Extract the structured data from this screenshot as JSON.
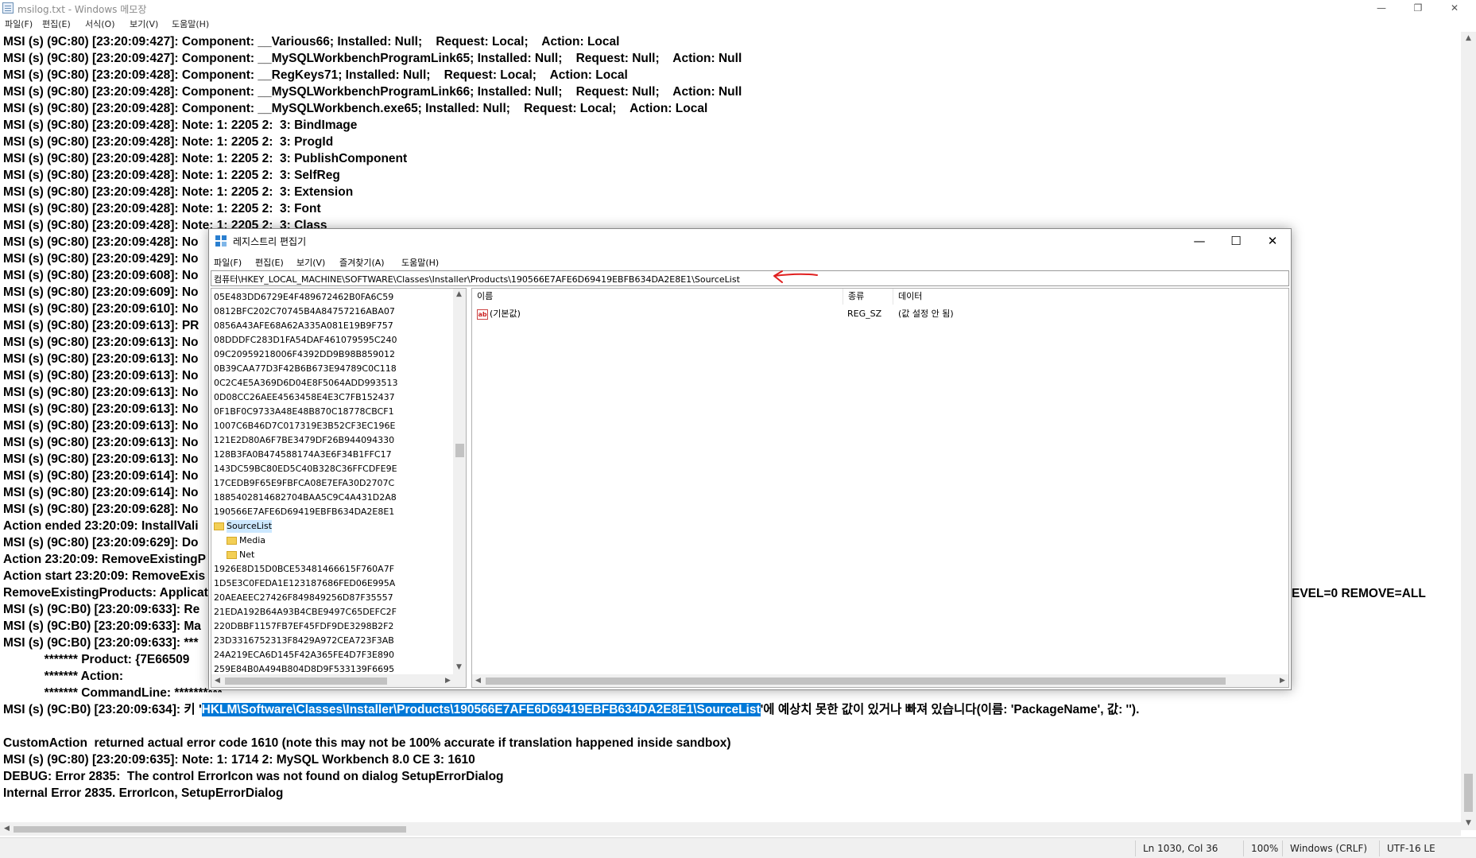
{
  "notepad": {
    "title": "msilog.txt - Windows 메모장",
    "menu": [
      "파일(F)",
      "편집(E)",
      "서식(O)",
      "보기(V)",
      "도움말(H)"
    ],
    "lines": [
      "MSI (s) (9C:80) [23:20:09:427]: Component: __Various66; Installed: Null;    Request: Local;    Action: Local",
      "MSI (s) (9C:80) [23:20:09:427]: Component: __MySQLWorkbenchProgramLink65; Installed: Null;    Request: Null;    Action: Null",
      "MSI (s) (9C:80) [23:20:09:428]: Component: __RegKeys71; Installed: Null;    Request: Local;    Action: Local",
      "MSI (s) (9C:80) [23:20:09:428]: Component: __MySQLWorkbenchProgramLink66; Installed: Null;    Request: Null;    Action: Null",
      "MSI (s) (9C:80) [23:20:09:428]: Component: __MySQLWorkbench.exe65; Installed: Null;    Request: Local;    Action: Local",
      "MSI (s) (9C:80) [23:20:09:428]: Note: 1: 2205 2:  3: BindImage",
      "MSI (s) (9C:80) [23:20:09:428]: Note: 1: 2205 2:  3: ProgId",
      "MSI (s) (9C:80) [23:20:09:428]: Note: 1: 2205 2:  3: PublishComponent",
      "MSI (s) (9C:80) [23:20:09:428]: Note: 1: 2205 2:  3: SelfReg",
      "MSI (s) (9C:80) [23:20:09:428]: Note: 1: 2205 2:  3: Extension",
      "MSI (s) (9C:80) [23:20:09:428]: Note: 1: 2205 2:  3: Font",
      "MSI (s) (9C:80) [23:20:09:428]: Note: 1: 2205 2:  3: Class",
      "MSI (s) (9C:80) [23:20:09:428]: No",
      "MSI (s) (9C:80) [23:20:09:429]: No",
      "MSI (s) (9C:80) [23:20:09:608]: No",
      "MSI (s) (9C:80) [23:20:09:609]: No",
      "MSI (s) (9C:80) [23:20:09:610]: No",
      "MSI (s) (9C:80) [23:20:09:613]: PR",
      "MSI (s) (9C:80) [23:20:09:613]: No",
      "MSI (s) (9C:80) [23:20:09:613]: No",
      "MSI (s) (9C:80) [23:20:09:613]: No",
      "MSI (s) (9C:80) [23:20:09:613]: No",
      "MSI (s) (9C:80) [23:20:09:613]: No",
      "MSI (s) (9C:80) [23:20:09:613]: No",
      "MSI (s) (9C:80) [23:20:09:613]: No",
      "MSI (s) (9C:80) [23:20:09:613]: No",
      "MSI (s) (9C:80) [23:20:09:614]: No",
      "MSI (s) (9C:80) [23:20:09:614]: No",
      "MSI (s) (9C:80) [23:20:09:628]: No",
      "Action ended 23:20:09: InstallVali",
      "MSI (s) (9C:80) [23:20:09:629]: Do",
      "Action 23:20:09: RemoveExistingP",
      "Action start 23:20:09: RemoveExis",
      "RemoveExistingProducts: Applicat",
      "MSI (s) (9C:B0) [23:20:09:633]: Re",
      "MSI (s) (9C:B0) [23:20:09:633]: Ma",
      "MSI (s) (9C:B0) [23:20:09:633]: ***",
      "            ******* Product: {7E66509",
      "            ******* Action:",
      "            ******* CommandLine: **********"
    ],
    "line_right_fragment": "EVEL=0 REMOVE=ALL",
    "err_line_prefix": "MSI (s) (9C:B0) [23:20:09:634]: 키 '",
    "err_line_selected": "HKLM\\Software\\Classes\\Installer\\Products\\190566E7AFE6D69419EBFB634DA2E8E1\\SourceList",
    "err_line_suffix": "'에 예상치 못한 값이 있거나 빠져 있습니다(이름: 'PackageName', 값: '').",
    "tail_lines": [
      "CustomAction  returned actual error code 1610 (note this may not be 100% accurate if translation happened inside sandbox)",
      "MSI (s) (9C:80) [23:20:09:635]: Note: 1: 1714 2: MySQL Workbench 8.0 CE 3: 1610",
      "DEBUG: Error 2835:  The control ErrorIcon was not found on dialog SetupErrorDialog",
      "Internal Error 2835. ErrorIcon, SetupErrorDialog"
    ],
    "status": {
      "position": "Ln 1030, Col 36",
      "zoom": "100%",
      "line_ending": "Windows (CRLF)",
      "encoding": "UTF-16 LE"
    }
  },
  "regedit": {
    "title": "레지스트리 편집기",
    "menu": [
      "파일(F)",
      "편집(E)",
      "보기(V)",
      "즐겨찾기(A)",
      "도움말(H)"
    ],
    "address": "컴퓨터\\HKEY_LOCAL_MACHINE\\SOFTWARE\\Classes\\Installer\\Products\\190566E7AFE6D69419EBFB634DA2E8E1\\SourceList",
    "tree_before": [
      "05E483DD6729E4F489672462B0FA6C59",
      "0812BFC202C70745B4A84757216ABA07",
      "0856A43AFE68A62A335A081E19B9F757",
      "08DDDFC283D1FA54DAF461079595C240",
      "09C20959218006F4392DD9B98B859012",
      "0B39CAA77D3F42B6B673E94789C0C118",
      "0C2C4E5A369D6D04E8F5064ADD993513",
      "0D08CC26AEE4563458E4E3C7FB152437",
      "0F1BF0C9733A48E48B870C18778CBCF1",
      "1007C6B46D7C017319E3B52CF3EC196E",
      "121E2D80A6F7BE3479DF26B944094330",
      "128B3FA0B474588174A3E6F34B1FFC17",
      "143DC59BC80ED5C40B328C36FFCDFE9E",
      "17CEDB9F65E9FBFCA08E7EFA30D2707C",
      "1885402814682704BAA5C9C4A431D2A8",
      "190566E7AFE6D69419EBFB634DA2E8E1"
    ],
    "tree_selected": "SourceList",
    "tree_children": [
      "Media",
      "Net"
    ],
    "tree_after": [
      "1926E8D15D0BCE53481466615F760A7F",
      "1D5E3C0FEDA1E123187686FED06E995A",
      "20AEAEEC27426F849849256D87F35557",
      "21EDA192B64A93B4CBE9497C65DEFC2F",
      "220DBBF1157FB7EF45FDF9DE3298B2F2",
      "23D3316752313F8429A972CEA723F3AB",
      "24A219ECA6D145F42A365FE4D7F3E890",
      "259E84B0A494B804D8D9F533139F6695"
    ],
    "columns": {
      "name": "이름",
      "type": "종류",
      "data": "데이터"
    },
    "values": [
      {
        "name": "(기본값)",
        "type": "REG_SZ",
        "data": "(값 설정 안 됨)"
      }
    ]
  }
}
